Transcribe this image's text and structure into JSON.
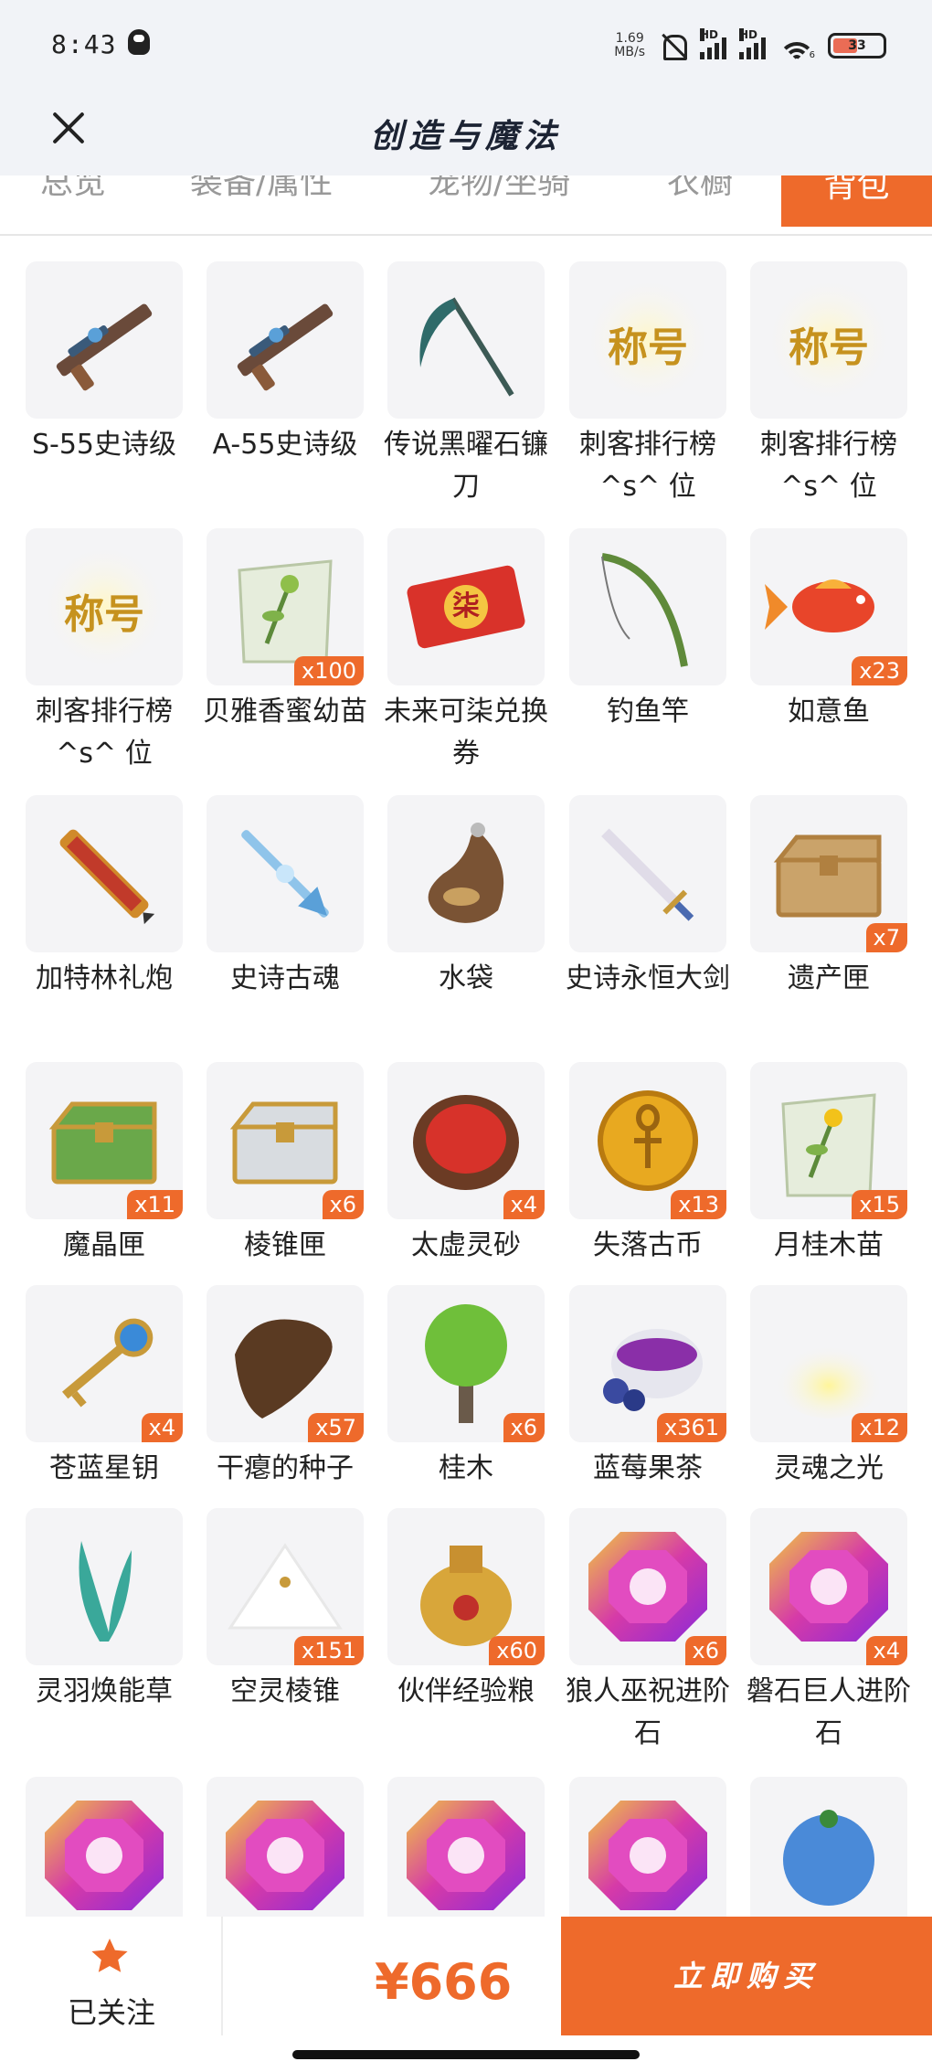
{
  "status": {
    "time": "8:43",
    "net_speed_value": "1.69",
    "net_speed_unit": "MB/s",
    "signal_label_1": "HD",
    "signal_label_2": "HD",
    "wifi_level": "6",
    "battery": "33"
  },
  "header": {
    "title": "创造与魔法"
  },
  "tabs": [
    {
      "label": "总览"
    },
    {
      "label": "装备/属性"
    },
    {
      "label": "宠物/坐骑"
    },
    {
      "label": "衣橱"
    },
    {
      "label": "背包"
    }
  ],
  "items": [
    {
      "name": "S-55史诗级",
      "count": "",
      "icon": "epic-rifle-icon"
    },
    {
      "name": "A-55史诗级",
      "count": "",
      "icon": "epic-rifle-icon"
    },
    {
      "name": "传说黑曜石镰刀",
      "count": "",
      "icon": "obsidian-scythe-icon"
    },
    {
      "name": "刺客排行榜^s^ 位",
      "count": "",
      "icon": "title-badge-icon",
      "badge_text": "称号"
    },
    {
      "name": "刺客排行榜^s^ 位",
      "count": "",
      "icon": "title-badge-icon",
      "badge_text": "称号"
    },
    {
      "name": "刺客排行榜^s^ 位",
      "count": "",
      "icon": "title-badge-icon",
      "badge_text": "称号"
    },
    {
      "name": "贝雅香蜜幼苗",
      "count": "x100",
      "icon": "seed-packet-icon"
    },
    {
      "name": "未来可柒兑换券",
      "count": "",
      "icon": "red-ticket-icon",
      "ticket_text": "柒"
    },
    {
      "name": "钓鱼竿",
      "count": "",
      "icon": "fishing-rod-icon"
    },
    {
      "name": "如意鱼",
      "count": "x23",
      "icon": "koi-fish-icon"
    },
    {
      "name": "加特林礼炮",
      "count": "",
      "icon": "gatling-cannon-icon"
    },
    {
      "name": "史诗古魂",
      "count": "",
      "icon": "ice-spear-icon"
    },
    {
      "name": "水袋",
      "count": "",
      "icon": "water-bag-icon"
    },
    {
      "name": "史诗永恒大剑",
      "count": "",
      "icon": "great-sword-icon"
    },
    {
      "name": "遗产匣",
      "count": "x7",
      "icon": "gold-chest-icon"
    },
    {
      "name": "魔晶匣",
      "count": "x11",
      "icon": "green-chest-icon"
    },
    {
      "name": "棱锥匣",
      "count": "x6",
      "icon": "silver-chest-icon"
    },
    {
      "name": "太虚灵砂",
      "count": "x4",
      "icon": "red-sand-bowl-icon"
    },
    {
      "name": "失落古币",
      "count": "x13",
      "icon": "gold-coin-icon"
    },
    {
      "name": "月桂木苗",
      "count": "x15",
      "icon": "seed-packet-yellow-icon"
    },
    {
      "name": "苍蓝星钥",
      "count": "x4",
      "icon": "star-key-icon"
    },
    {
      "name": "干瘪的种子",
      "count": "x57",
      "icon": "dry-seed-icon"
    },
    {
      "name": "桂木",
      "count": "x6",
      "icon": "tree-icon"
    },
    {
      "name": "蓝莓果茶",
      "count": "x361",
      "icon": "berry-tea-icon"
    },
    {
      "name": "灵魂之光",
      "count": "x12",
      "icon": "soul-light-icon"
    },
    {
      "name": "灵羽焕能草",
      "count": "",
      "icon": "feather-grass-icon"
    },
    {
      "name": "空灵棱锥",
      "count": "x151",
      "icon": "white-pyramid-icon"
    },
    {
      "name": "伙伴经验粮",
      "count": "x60",
      "icon": "pet-food-bag-icon"
    },
    {
      "name": "狼人巫祝进阶石",
      "count": "x6",
      "icon": "advance-gem-icon"
    },
    {
      "name": "磐石巨人进阶石",
      "count": "x4",
      "icon": "advance-gem-icon"
    },
    {
      "name": "",
      "count": "",
      "icon": "advance-gem-icon"
    },
    {
      "name": "",
      "count": "",
      "icon": "advance-gem-icon"
    },
    {
      "name": "",
      "count": "",
      "icon": "advance-gem-icon"
    },
    {
      "name": "",
      "count": "",
      "icon": "advance-gem-icon"
    },
    {
      "name": "",
      "count": "",
      "icon": "blue-fruit-icon"
    }
  ],
  "footer": {
    "fav_label": "已关注",
    "price": "¥666",
    "buy_label": "立即购买"
  },
  "colors": {
    "accent": "#ee6a2b",
    "header_bg": "#f1f3f7"
  }
}
